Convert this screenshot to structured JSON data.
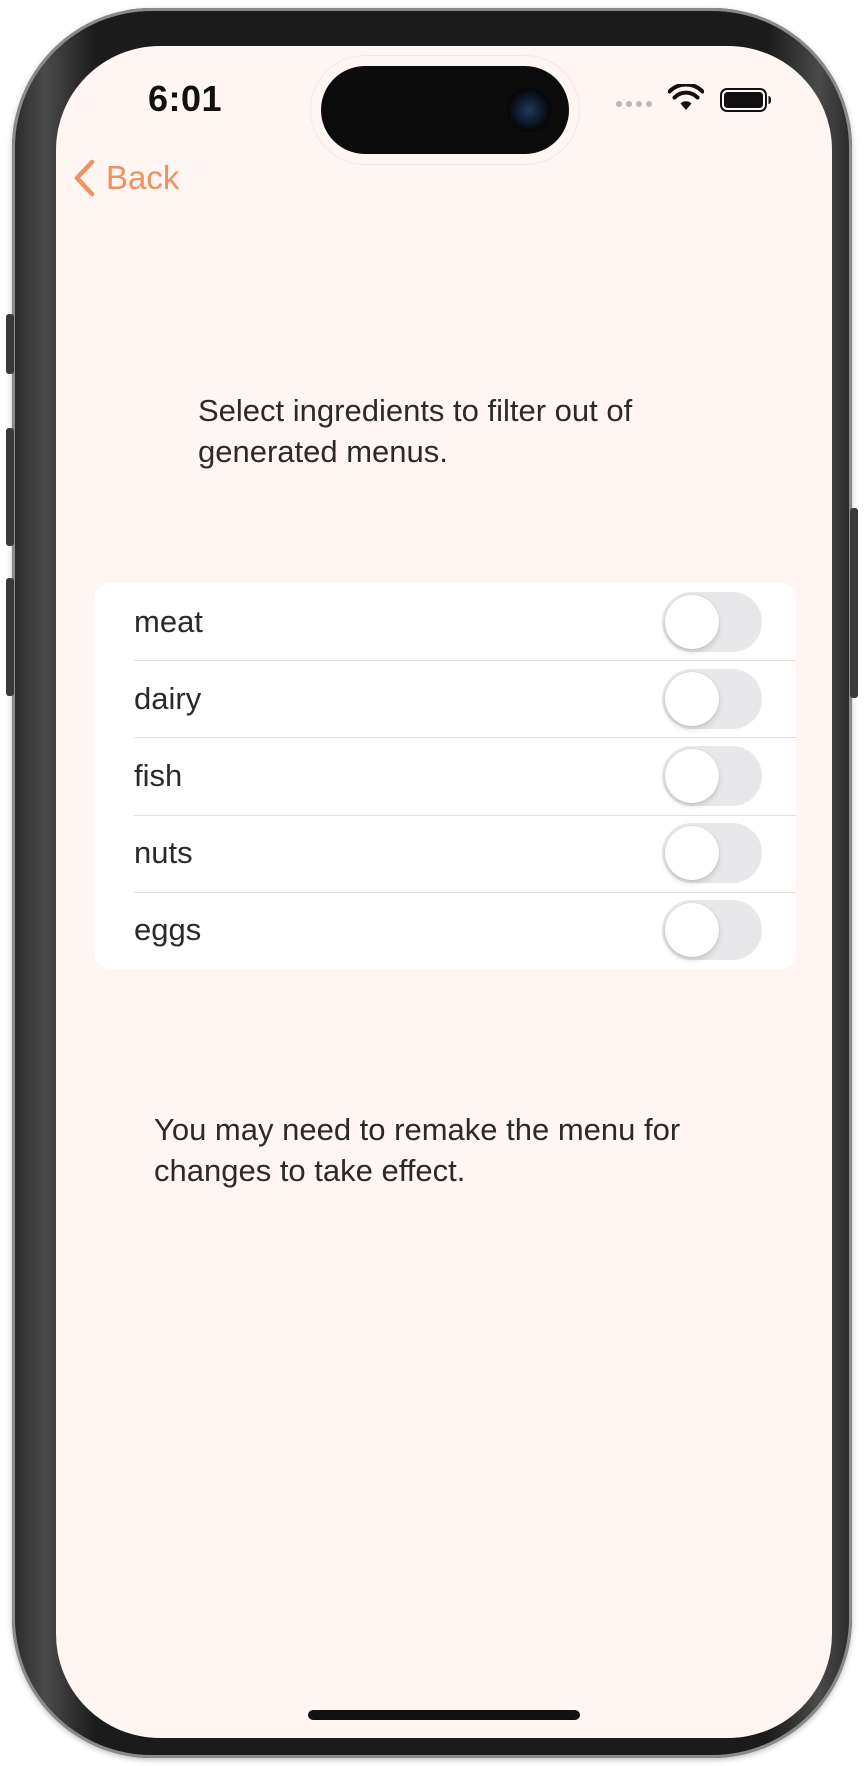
{
  "status_bar": {
    "time": "6:01"
  },
  "nav": {
    "back_label": "Back",
    "accent_color": "#f0915f"
  },
  "intro_text": "Select ingredients to filter out of generated menus.",
  "filters": [
    {
      "label": "meat",
      "enabled": false
    },
    {
      "label": "dairy",
      "enabled": false
    },
    {
      "label": "fish",
      "enabled": false
    },
    {
      "label": "nuts",
      "enabled": false
    },
    {
      "label": "eggs",
      "enabled": false
    }
  ],
  "footer_note": "You may need to remake the menu for changes to take effect.",
  "colors": {
    "background": "#fff5f2",
    "card": "#ffffff",
    "toggle_off": "#e8e8ea",
    "text": "#2a2a2a"
  },
  "icons": {
    "back": "chevron-left-icon",
    "wifi": "wifi-icon",
    "battery": "battery-icon"
  }
}
